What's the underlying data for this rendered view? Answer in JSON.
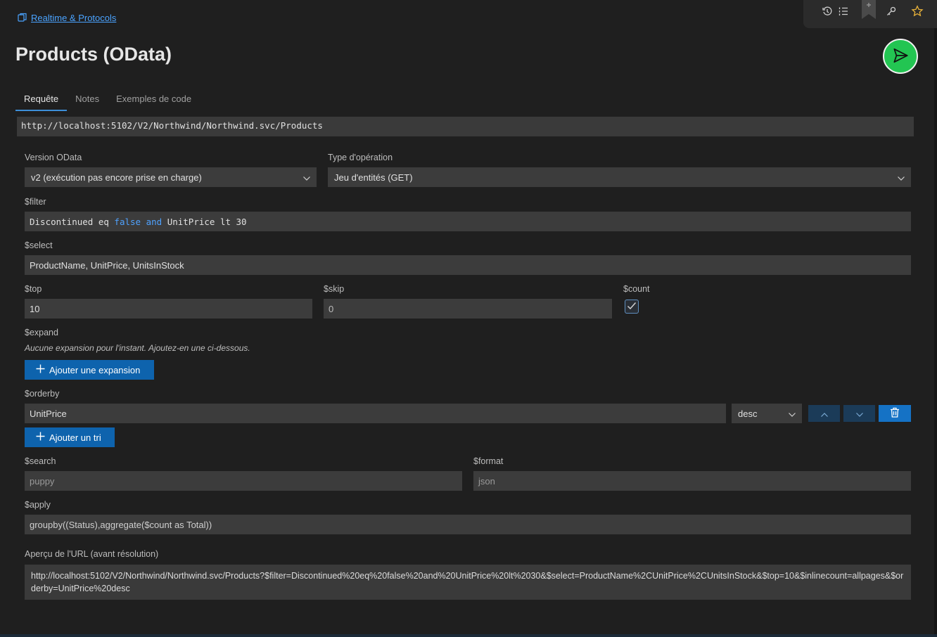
{
  "breadcrumb": {
    "label": "Realtime & Protocols"
  },
  "page": {
    "title": "Products (OData)"
  },
  "toolbar": {
    "icons": [
      "history-icon",
      "list-icon",
      "bookmark-icon",
      "key-icon",
      "star-icon"
    ],
    "star_color": "#e8b23a"
  },
  "tabs": [
    {
      "label": "Requête",
      "active": true
    },
    {
      "label": "Notes",
      "active": false
    },
    {
      "label": "Exemples de code",
      "active": false
    }
  ],
  "url": "http://localhost:5102/V2/Northwind/Northwind.svc/Products",
  "odata_version": {
    "label": "Version OData",
    "value": "v2 (exécution pas encore prise en charge)"
  },
  "operation_type": {
    "label": "Type d'opération",
    "value": "Jeu d'entités (GET)"
  },
  "filter": {
    "label": "$filter",
    "tokens": {
      "t1": "Discontinued eq ",
      "t2": "false",
      "t3": " ",
      "t4": "and",
      "t5": " UnitPrice lt 30"
    }
  },
  "select": {
    "label": "$select",
    "value": "ProductName, UnitPrice, UnitsInStock"
  },
  "top": {
    "label": "$top",
    "value": "10"
  },
  "skip": {
    "label": "$skip",
    "value": "0"
  },
  "count": {
    "label": "$count",
    "checked": true
  },
  "expand": {
    "label": "$expand",
    "hint": "Aucune expansion pour l'instant. Ajoutez-en une ci-dessous.",
    "add_button": "Ajouter une expansion"
  },
  "orderby": {
    "label": "$orderby",
    "field": "UnitPrice",
    "direction": "desc",
    "add_button": "Ajouter un tri"
  },
  "search": {
    "label": "$search",
    "value": "puppy"
  },
  "format": {
    "label": "$format",
    "value": "json"
  },
  "apply": {
    "label": "$apply",
    "value": "groupby((Status),aggregate($count as Total))"
  },
  "preview": {
    "label": "Aperçu de l'URL (avant résolution)",
    "value": "http://localhost:5102/V2/Northwind/Northwind.svc/Products?$filter=Discontinued%20eq%20false%20and%20UnitPrice%20lt%2030&$select=ProductName%2CUnitPrice%2CUnitsInStock&$top=10&$inlinecount=allpages&$orderby=UnitPrice%20desc"
  },
  "colors": {
    "accent": "#0e63ad",
    "send": "#23c552",
    "keyword": "#4fa2ff",
    "background": "#1f1f1f"
  }
}
